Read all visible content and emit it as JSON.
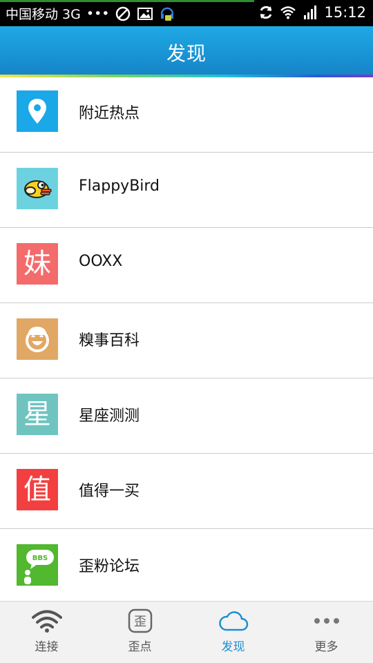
{
  "status_bar": {
    "carrier": "中国移动 3G",
    "dots": "•••",
    "time": "15:12"
  },
  "header": {
    "title": "发现"
  },
  "list": {
    "items": [
      {
        "label": "附近热点",
        "icon": "location-pin-icon",
        "color": "#1aa8e8"
      },
      {
        "label": "FlappyBird",
        "icon": "flappy-bird-icon",
        "color": "#6cd2e0"
      },
      {
        "label": "OOXX",
        "icon": "mei-char-icon",
        "icon_text": "妹",
        "color": "#f36b6b"
      },
      {
        "label": "糗事百科",
        "icon": "laughing-face-icon",
        "color": "#e1a764"
      },
      {
        "label": "星座测测",
        "icon": "xing-char-icon",
        "icon_text": "星",
        "color": "#6fc4c0"
      },
      {
        "label": "值得一买",
        "icon": "zhi-char-icon",
        "icon_text": "值",
        "color": "#f33f3f"
      },
      {
        "label": "歪粉论坛",
        "icon": "bbs-bubble-icon",
        "icon_text": "BBS",
        "color": "#51b82f"
      }
    ]
  },
  "bottom_nav": {
    "tabs": [
      {
        "label": "连接",
        "icon": "wifi-icon"
      },
      {
        "label": "歪点",
        "icon": "wai-badge-icon",
        "icon_text": "歪"
      },
      {
        "label": "发现",
        "icon": "cloud-icon",
        "active": true
      },
      {
        "label": "更多",
        "icon": "more-dots-icon"
      }
    ],
    "active_color": "#1c8fd1"
  }
}
